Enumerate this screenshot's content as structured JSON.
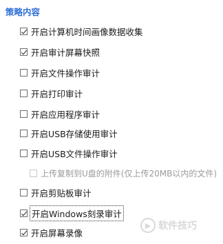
{
  "section": {
    "title": "策略内容"
  },
  "options": [
    {
      "label": "开启计算机时间画像数据收集",
      "checked": true
    },
    {
      "label": "开启审计屏幕快照",
      "checked": true
    },
    {
      "label": "开启文件操作审计",
      "checked": false
    },
    {
      "label": "开启打印审计",
      "checked": false
    },
    {
      "label": "开启应用程序审计",
      "checked": false
    },
    {
      "label": "开启USB存储使用审计",
      "checked": false
    },
    {
      "label": "开启USB文件操作审计",
      "checked": false
    },
    {
      "label": "上传复制到U盘的附件(仅上传20MB以内的文件)",
      "checked": false,
      "disabled": true
    },
    {
      "label": "开启剪贴板审计",
      "checked": false
    },
    {
      "label": "开启Windows刻录审计",
      "checked": true
    },
    {
      "label": "开启屏幕录像",
      "checked": true
    }
  ],
  "watermark": {
    "text": "软件技巧"
  }
}
